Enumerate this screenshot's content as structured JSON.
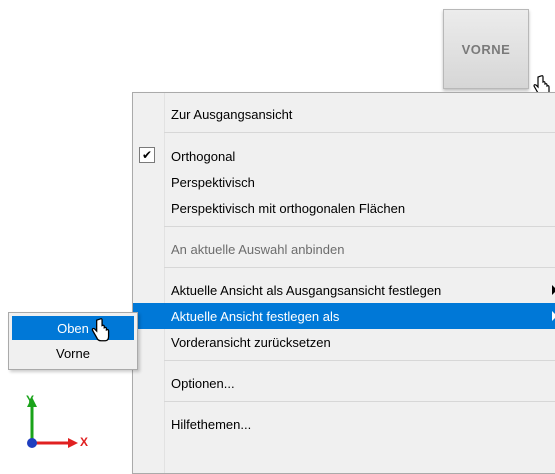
{
  "viewcube": {
    "face_label": "VORNE"
  },
  "context_menu": {
    "items": [
      {
        "label": "Zur Ausgangsansicht"
      },
      {
        "label": "Orthogonal",
        "checked": true
      },
      {
        "label": "Perspektivisch"
      },
      {
        "label": "Perspektivisch mit orthogonalen Flächen"
      },
      {
        "label": "An aktuelle Auswahl anbinden",
        "disabled": true
      },
      {
        "label": "Aktuelle Ansicht als Ausgangsansicht festlegen",
        "has_submenu": true
      },
      {
        "label": "Aktuelle Ansicht festlegen als",
        "has_submenu": true,
        "selected": true
      },
      {
        "label": "Vorderansicht zurücksetzen"
      },
      {
        "label": "Optionen..."
      },
      {
        "label": "Hilfethemen..."
      }
    ]
  },
  "submenu": {
    "items": [
      {
        "label": "Oben",
        "selected": true
      },
      {
        "label": "Vorne"
      }
    ]
  },
  "axis_triad": {
    "y_label": "Y",
    "x_label": "X",
    "y_color": "#1aa31a",
    "x_color": "#e02020",
    "origin_color": "#1f3fbf"
  },
  "colors": {
    "highlight": "#0078d7",
    "menu_bg": "#f0f0f0"
  }
}
